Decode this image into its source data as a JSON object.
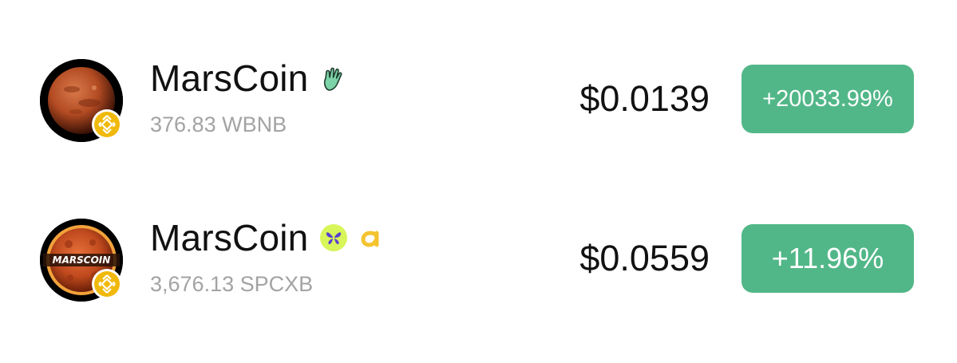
{
  "tokens": [
    {
      "name": "MarsCoin",
      "amount": "376.83 WBNB",
      "price": "$0.0139",
      "change": "+20033.99%",
      "platform_icons": [
        "vulcan-hand-icon"
      ],
      "logo": "mars-planet-logo"
    },
    {
      "name": "MarsCoin",
      "amount": "3,676.13 SPCXB",
      "price": "$0.0559",
      "change": "+11.96%",
      "platform_icons": [
        "butterfly-icon",
        "alpha-icon"
      ],
      "logo": "marscoin-logo",
      "logo_text": "MARSCOIN"
    }
  ],
  "colors": {
    "change_positive": "#52b788",
    "secondary_text": "#a3a3a3",
    "badge_gold": "#f0b90b"
  }
}
